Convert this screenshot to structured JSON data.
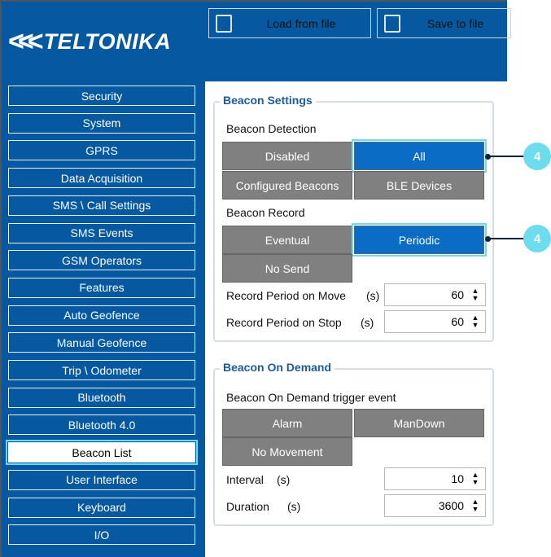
{
  "header": {
    "logo_text": "TELTONIKA",
    "load_label": "Load from file",
    "save_label": "Save to file"
  },
  "sidebar": {
    "items": [
      {
        "label": "Security"
      },
      {
        "label": "System"
      },
      {
        "label": "GPRS"
      },
      {
        "label": "Data Acquisition"
      },
      {
        "label": "SMS \\ Call Settings"
      },
      {
        "label": "SMS Events"
      },
      {
        "label": "GSM Operators"
      },
      {
        "label": "Features"
      },
      {
        "label": "Auto Geofence"
      },
      {
        "label": "Manual Geofence"
      },
      {
        "label": "Trip \\ Odometer"
      },
      {
        "label": "Bluetooth"
      },
      {
        "label": "Bluetooth 4.0"
      },
      {
        "label": "Beacon List",
        "active": true
      },
      {
        "label": "User Interface"
      },
      {
        "label": "Keyboard"
      },
      {
        "label": "I/O"
      }
    ]
  },
  "beacon_settings": {
    "title": "Beacon Settings",
    "detection_label": "Beacon Detection",
    "detection_options": [
      "Disabled",
      "All",
      "Configured Beacons",
      "BLE Devices"
    ],
    "detection_selected": "All",
    "record_label": "Beacon Record",
    "record_options": [
      "Eventual",
      "Periodic",
      "No Send"
    ],
    "record_selected": "Periodic",
    "move_label": "Record Period on Move",
    "move_unit": "(s)",
    "move_value": "60",
    "stop_label": "Record Period on Stop",
    "stop_unit": "(s)",
    "stop_value": "60"
  },
  "beacon_on_demand": {
    "title": "Beacon On Demand",
    "trigger_label": "Beacon On Demand trigger event",
    "trigger_options": [
      "Alarm",
      "ManDown",
      "No Movement"
    ],
    "interval_label": "Interval",
    "interval_unit": "(s)",
    "interval_value": "10",
    "duration_label": "Duration",
    "duration_unit": "(s)",
    "duration_value": "3600"
  },
  "callouts": [
    "4",
    "4"
  ]
}
